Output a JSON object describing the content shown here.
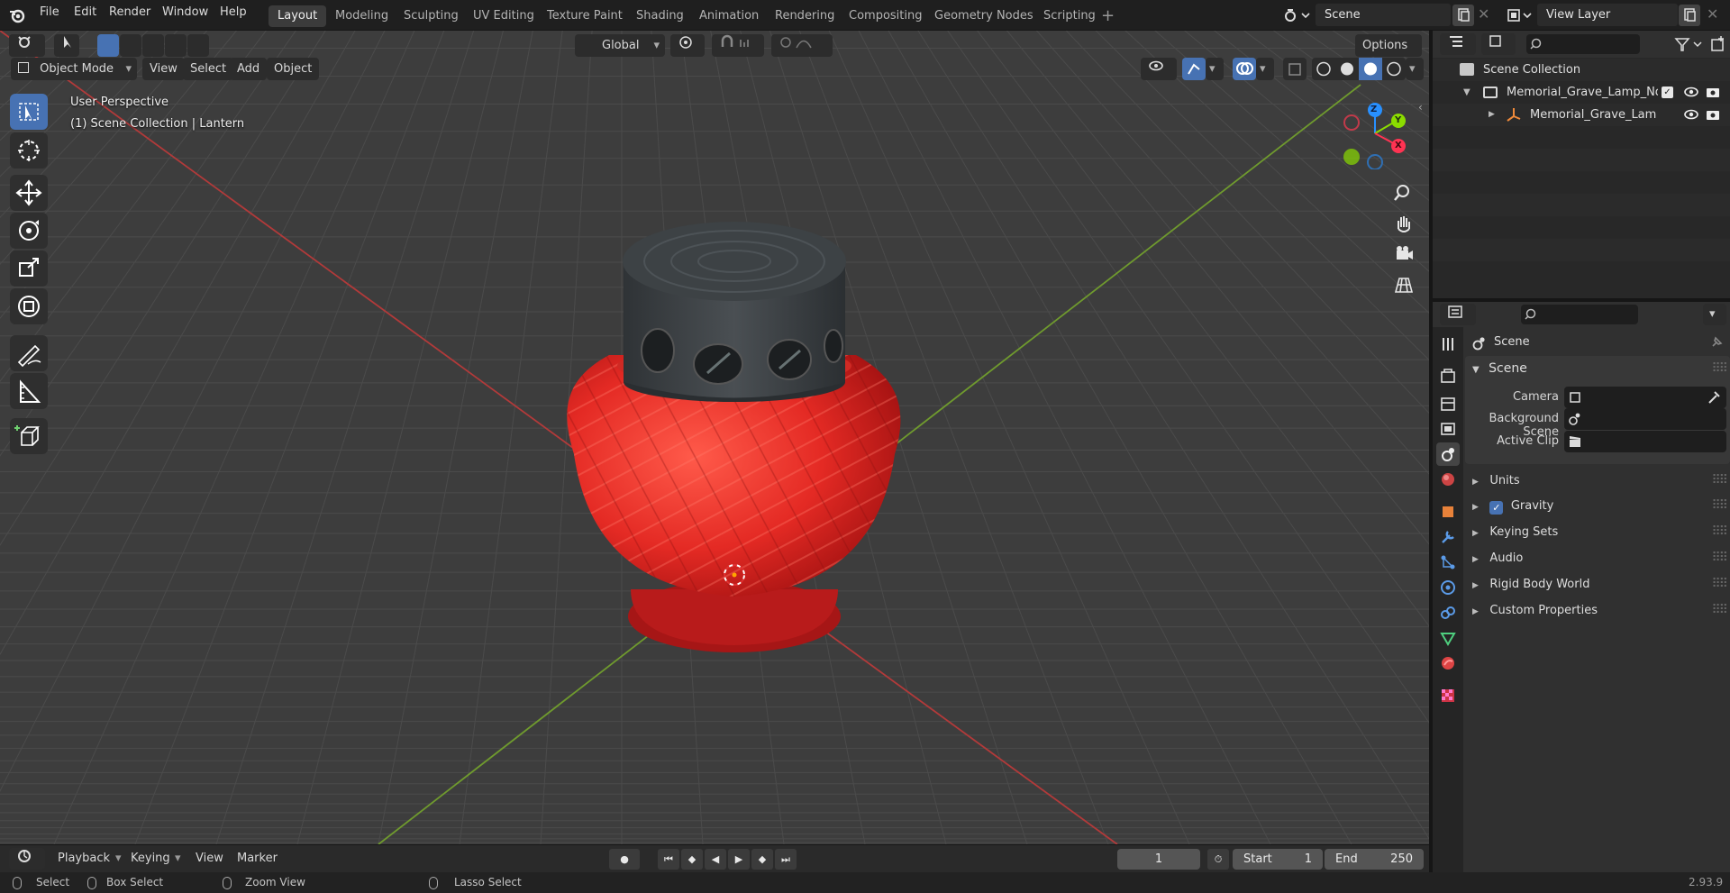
{
  "menu": [
    "File",
    "Edit",
    "Render",
    "Window",
    "Help"
  ],
  "workspaces": [
    "Layout",
    "Modeling",
    "Sculpting",
    "UV Editing",
    "Texture Paint",
    "Shading",
    "Animation",
    "Rendering",
    "Compositing",
    "Geometry Nodes",
    "Scripting"
  ],
  "active_workspace": "Layout",
  "scene_name": "Scene",
  "view_layer": "View Layer",
  "viewport": {
    "mode": "Object Mode",
    "menus": [
      "View",
      "Select",
      "Add",
      "Object"
    ],
    "transform_orientation": "Global",
    "options_label": "Options",
    "overlay_line1": "User Perspective",
    "overlay_line2": "(1) Scene Collection | Lantern",
    "gizmo_axes": {
      "x": "X",
      "y": "Y",
      "z": "Z"
    }
  },
  "outliner": {
    "root": "Scene Collection",
    "items": [
      {
        "label": "Memorial_Grave_Lamp_No_C"
      },
      {
        "label": "Memorial_Grave_Lamp_N"
      }
    ]
  },
  "properties": {
    "context_title": "Scene",
    "panel_title": "Scene",
    "fields": [
      {
        "label": "Camera"
      },
      {
        "label": "Background Scene"
      },
      {
        "label": "Active Clip"
      }
    ],
    "subpanels": [
      "Units",
      "Gravity",
      "Keying Sets",
      "Audio",
      "Rigid Body World",
      "Custom Properties"
    ],
    "gravity_checked": true
  },
  "timeline": {
    "menus": [
      "Playback",
      "Keying",
      "View",
      "Marker"
    ],
    "current_frame": "1",
    "start_label": "Start",
    "start_value": "1",
    "end_label": "End",
    "end_value": "250"
  },
  "statusbar": {
    "items": [
      "Select",
      "Box Select",
      "Zoom View",
      "Lasso Select"
    ],
    "version": "2.93.9"
  },
  "colors": {
    "accent": "#4772b3",
    "axis_x": "#ff3352",
    "axis_y": "#8bdc00",
    "axis_z": "#2890ff",
    "lantern_red": "#e02424",
    "lantern_cap": "#3a3f43"
  }
}
